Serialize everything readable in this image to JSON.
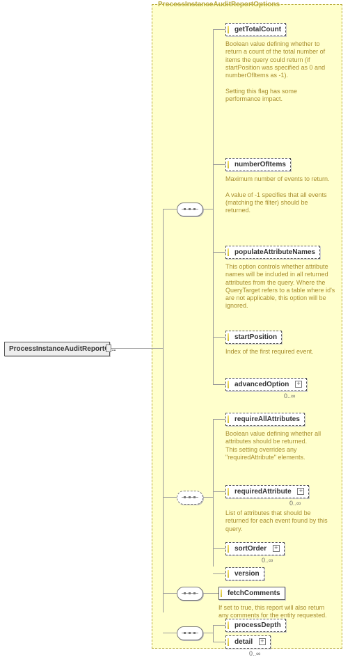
{
  "panel": {
    "title": "ProcessInstanceAuditReportOptions"
  },
  "root": {
    "label": "ProcessInstanceAuditReportO..."
  },
  "elements": {
    "getTotalCount": {
      "label": "getTotalCount",
      "desc": "Boolean value defining whether to return a count of the total number of items the query could return (if startPosition was specified as 0 and numberOfItems as -1).\n\nSetting this flag has some performance impact."
    },
    "numberOfItems": {
      "label": "numberOfItems",
      "desc": "Maximum number of events to return.\n\nA value of -1 specifies that all events (matching the filter) should be returned."
    },
    "populateAttributeNames": {
      "label": "populateAttributeNames",
      "desc": "This option controls whether attribute names will be included in all returned attributes from the query. Where the QueryTarget refers to a table where id's are not applicable, this option will be ignored."
    },
    "startPosition": {
      "label": "startPosition",
      "desc": "Index of the first required event."
    },
    "advancedOption": {
      "label": "advancedOption",
      "card": "0..∞"
    },
    "requireAllAttributes": {
      "label": "requireAllAttributes",
      "desc": "Boolean value defining whether all attributes should be returned.\nThis setting overrides any \"requiredAttribute\" elements."
    },
    "requiredAttribute": {
      "label": "requiredAttribute",
      "card": "0..∞",
      "desc": "List of attributes that should be returned for each event found by this query."
    },
    "sortOrder": {
      "label": "sortOrder",
      "card": "0..∞"
    },
    "version": {
      "label": "version"
    },
    "fetchComments": {
      "label": "fetchComments",
      "desc": "If set to true, this report will also return any comments for the entity requested."
    },
    "processDepth": {
      "label": "processDepth"
    },
    "detail": {
      "label": "detail",
      "card": "0..∞"
    }
  }
}
